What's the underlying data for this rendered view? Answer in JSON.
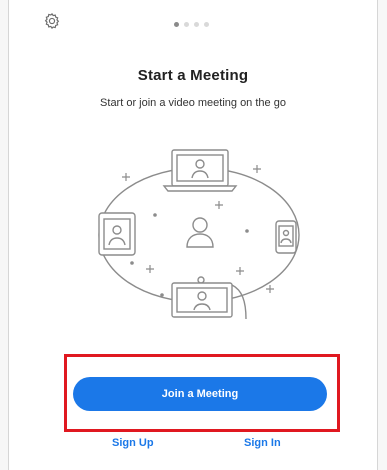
{
  "pager": {
    "pages": 4,
    "active_index": 0
  },
  "onboarding": {
    "title": "Start a Meeting",
    "subtitle": "Start or join a video meeting on the go"
  },
  "actions": {
    "join_label": "Join a Meeting",
    "signup_label": "Sign Up",
    "signin_label": "Sign In"
  },
  "icons": {
    "settings": "gear-icon"
  },
  "colors": {
    "accent": "#1b78e8",
    "highlight": "#e01820",
    "illustration": "#8c8c8c"
  }
}
